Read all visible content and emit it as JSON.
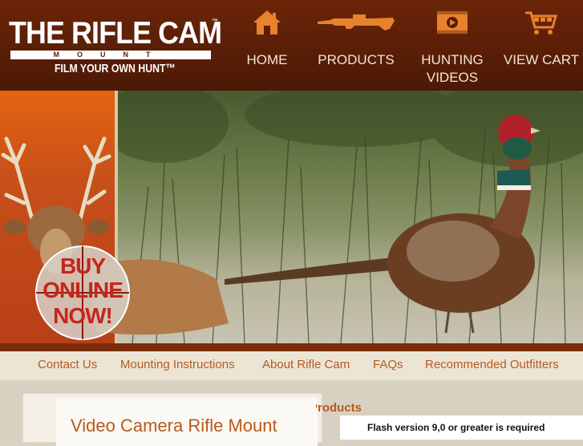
{
  "brand": {
    "title": "THE RIFLE CAM",
    "tm": "™",
    "subtitle": "MOUNT",
    "tagline": "FILM YOUR OWN HUNT™"
  },
  "nav": [
    {
      "label": "HOME",
      "icon": "home-icon"
    },
    {
      "label": "PRODUCTS",
      "icon": "rifle-icon"
    },
    {
      "label_line1": "HUNTING",
      "label_line2": "VIDEOS",
      "icon": "video-icon"
    },
    {
      "label": "VIEW CART",
      "icon": "cart-icon"
    }
  ],
  "hero": {
    "badge_line1": "BUY",
    "badge_line2": "ONLINE",
    "badge_line3": "NOW!"
  },
  "subnav": [
    {
      "label": "Contact Us"
    },
    {
      "label": "Mounting Instructions"
    },
    {
      "label": "About Rifle Cam"
    },
    {
      "label": "FAQs"
    },
    {
      "label": "Recommended Outfitters"
    }
  ],
  "main": {
    "card_title": "Video Camera Rifle Mount",
    "products_heading": "Products",
    "flash_note": "Flash version 9,0 or greater is required"
  },
  "colors": {
    "header_bg": "#5a1e07",
    "accent_orange": "#b85a1e",
    "icon_orange": "#e8822c",
    "subnav_bg": "#ece5d6"
  }
}
